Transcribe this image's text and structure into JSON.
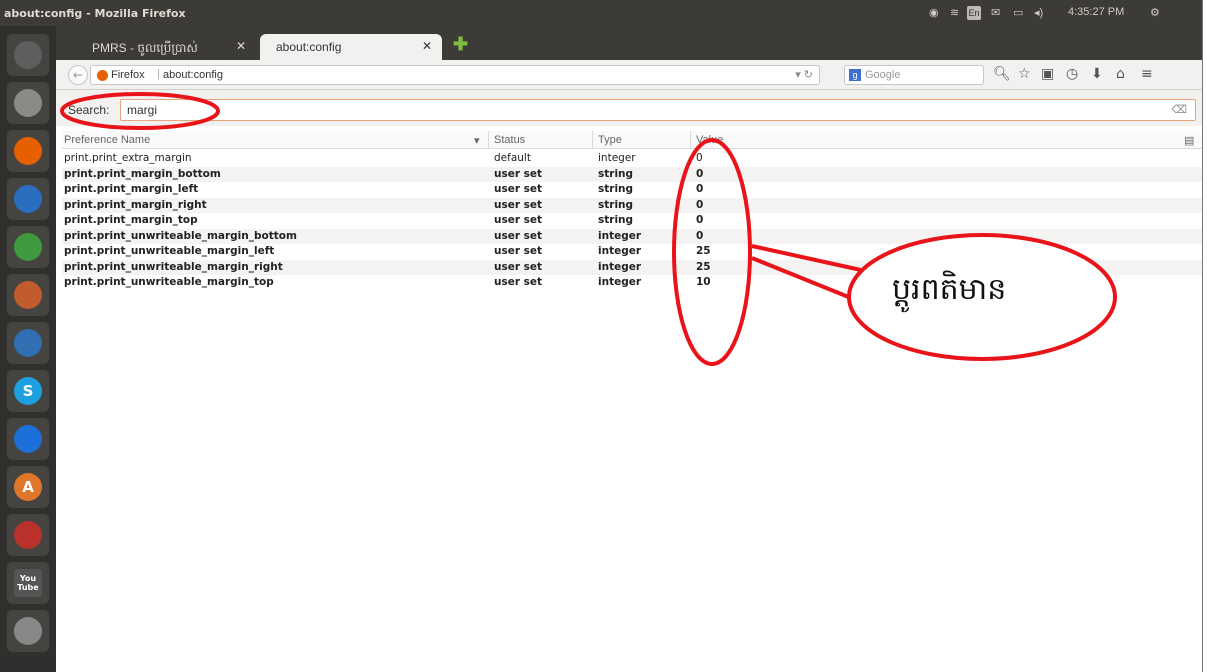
{
  "window": {
    "title": "about:config - Mozilla Firefox"
  },
  "tray": {
    "keyboard": "En",
    "clock": "4:35:27 PM"
  },
  "launcher": {
    "items": [
      {
        "name": "ubuntu-dash-icon",
        "label": "",
        "color": "#5e5e5e"
      },
      {
        "name": "files-icon",
        "label": "",
        "color": "#8a8a86"
      },
      {
        "name": "firefox-icon",
        "label": "",
        "color": "#e66000"
      },
      {
        "name": "libreoffice-writer-icon",
        "label": "",
        "color": "#2a6fbf"
      },
      {
        "name": "libreoffice-calc-icon",
        "label": "",
        "color": "#3f9a3f"
      },
      {
        "name": "libreoffice-impress-icon",
        "label": "",
        "color": "#c25b2e"
      },
      {
        "name": "thunderbird-icon",
        "label": "",
        "color": "#2f6fb2"
      },
      {
        "name": "skype-icon",
        "label": "S",
        "color": "#1e9fe0"
      },
      {
        "name": "teamviewer-icon",
        "label": "",
        "color": "#1c6fd6"
      },
      {
        "name": "software-center-icon",
        "label": "A",
        "color": "#e0762a"
      },
      {
        "name": "system-settings-icon",
        "label": "",
        "color": "#b9322c"
      },
      {
        "name": "youtube-icon",
        "label": "You Tube",
        "color": "#555"
      },
      {
        "name": "trash-icon",
        "label": "",
        "color": "#888"
      }
    ]
  },
  "tabs": [
    {
      "label": "PMRS - ចូលប្រើប្រាស់"
    },
    {
      "label": "about:config"
    }
  ],
  "navbar": {
    "site_identity": "Firefox",
    "url": "about:config",
    "search_engine": "Google"
  },
  "search": {
    "label": "Search:",
    "value": "margi"
  },
  "columns": {
    "name": "Preference Name",
    "status": "Status",
    "type": "Type",
    "value": "Value"
  },
  "rows": [
    {
      "name": "print.print_extra_margin",
      "status": "default",
      "type": "integer",
      "value": "0"
    },
    {
      "name": "print.print_margin_bottom",
      "status": "user set",
      "type": "string",
      "value": "0"
    },
    {
      "name": "print.print_margin_left",
      "status": "user set",
      "type": "string",
      "value": "0"
    },
    {
      "name": "print.print_margin_right",
      "status": "user set",
      "type": "string",
      "value": "0"
    },
    {
      "name": "print.print_margin_top",
      "status": "user set",
      "type": "string",
      "value": "0"
    },
    {
      "name": "print.print_unwriteable_margin_bottom",
      "status": "user set",
      "type": "integer",
      "value": "0"
    },
    {
      "name": "print.print_unwriteable_margin_left",
      "status": "user set",
      "type": "integer",
      "value": "25"
    },
    {
      "name": "print.print_unwriteable_margin_right",
      "status": "user set",
      "type": "integer",
      "value": "25"
    },
    {
      "name": "print.print_unwriteable_margin_top",
      "status": "user set",
      "type": "integer",
      "value": "10"
    }
  ],
  "annotation": {
    "text": "ប្តូរពតិមាន",
    "color": "#e8141a"
  }
}
